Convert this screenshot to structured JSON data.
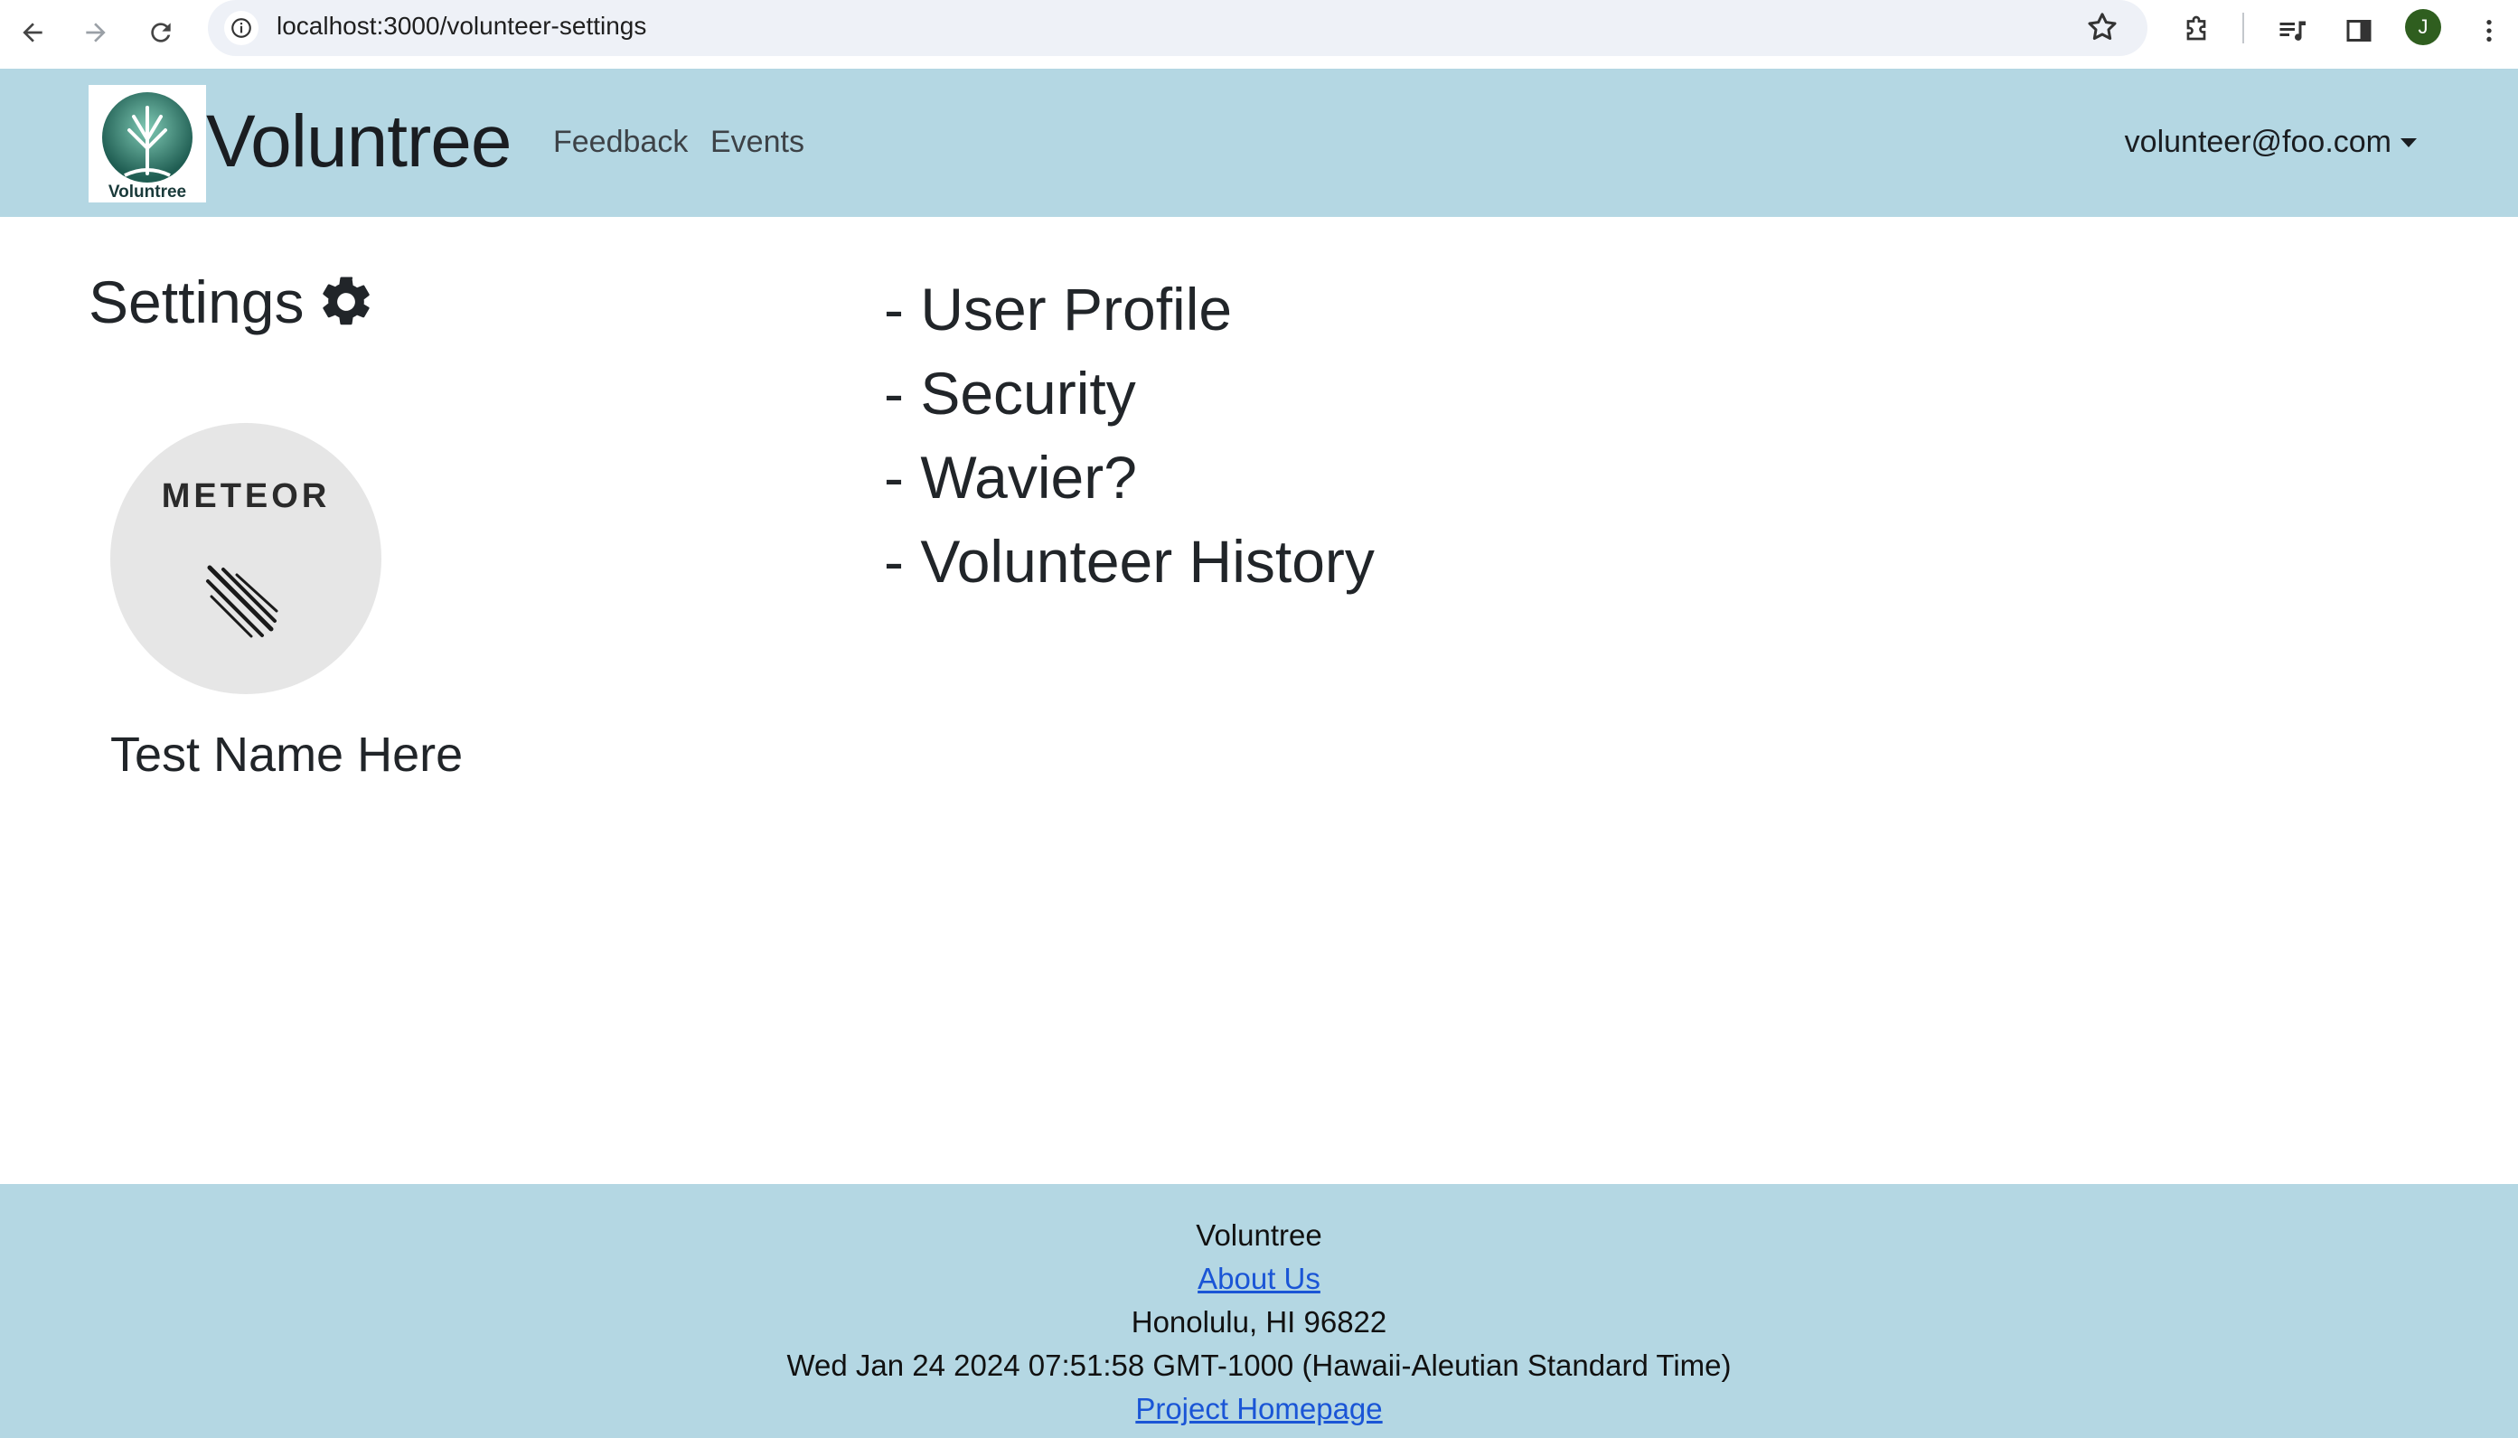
{
  "browser": {
    "url": "localhost:3000/volunteer-settings",
    "profile_initial": "J"
  },
  "navbar": {
    "brand": "Voluntree",
    "logo_text": "Voluntree",
    "links": [
      "Feedback",
      "Events"
    ],
    "user_email": "volunteer@foo.com"
  },
  "settings": {
    "title": "Settings",
    "title_icon": "gear-icon",
    "avatar_logo_text": "METEOR",
    "profile_name": "Test Name Here",
    "menu_items": [
      "- User Profile",
      "- Security",
      "- Wavier?",
      "- Volunteer History"
    ]
  },
  "footer": {
    "name": "Voluntree",
    "about_link": "About Us",
    "location": "Honolulu, HI 96822",
    "datetime": "Wed Jan 24 2024 07:51:58 GMT-1000 (Hawaii-Aleutian Standard Time)",
    "homepage_link": "Project Homepage"
  },
  "colors": {
    "navbar_bg": "#b4d7e3",
    "footer_bg": "#b4d7e3",
    "link": "#1a55d6",
    "meteor_accent": "#d9534f"
  }
}
